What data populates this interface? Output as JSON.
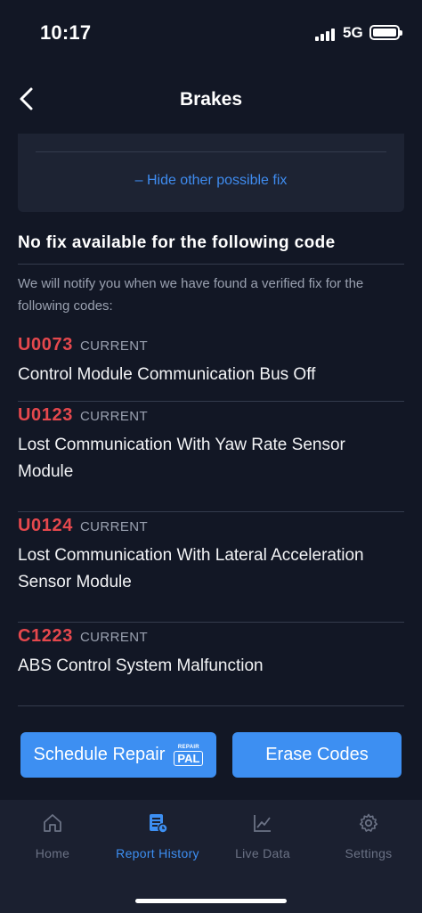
{
  "status_bar": {
    "time": "10:17",
    "network": "5G"
  },
  "header": {
    "title": "Brakes"
  },
  "fix_card": {
    "hide_label": "– Hide other possible fix"
  },
  "section": {
    "title": "No fix available for the following code",
    "notify_text": "We will notify you when we have found a verified fix for the following codes:"
  },
  "codes": [
    {
      "code": "U0073",
      "status": "CURRENT",
      "description": "Control Module Communication Bus Off"
    },
    {
      "code": "U0123",
      "status": "CURRENT",
      "description": "Lost Communication With Yaw Rate Sensor Module"
    },
    {
      "code": "U0124",
      "status": "CURRENT",
      "description": "Lost Communication With Lateral Acceleration Sensor Module"
    },
    {
      "code": "C1223",
      "status": "CURRENT",
      "description": "ABS Control System Malfunction"
    }
  ],
  "actions": {
    "schedule_label": "Schedule Repair",
    "badge_top": "REPAIR",
    "badge_main": "PAL",
    "erase_label": "Erase Codes"
  },
  "tabs": [
    {
      "label": "Home",
      "icon": "home-icon",
      "active": false
    },
    {
      "label": "Report History",
      "icon": "report-icon",
      "active": true
    },
    {
      "label": "Live Data",
      "icon": "chart-icon",
      "active": false
    },
    {
      "label": "Settings",
      "icon": "gear-icon",
      "active": false
    }
  ],
  "colors": {
    "accent": "#3d8ff2",
    "code_red": "#e5484d",
    "background": "#121725"
  }
}
